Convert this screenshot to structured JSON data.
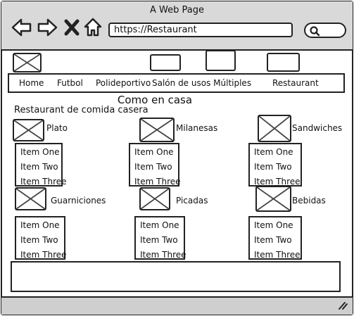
{
  "window": {
    "title": "A Web Page"
  },
  "browser": {
    "url": "https://Restaurant",
    "back_icon": "back-arrow-icon",
    "forward_icon": "forward-arrow-icon",
    "stop_icon": "close-icon",
    "home_icon": "home-icon",
    "search_icon": "search-icon"
  },
  "menu": {
    "items": [
      {
        "label": "Home"
      },
      {
        "label": "Futbol"
      },
      {
        "label": "Polideportivo"
      },
      {
        "label": "Salón de usos Múltiples"
      },
      {
        "label": "Restaurant"
      }
    ]
  },
  "page": {
    "heading": "Como en casa",
    "subheading": "Restaurant de comida casera"
  },
  "categories": [
    {
      "name": "Plato",
      "items": [
        "Item One",
        "Item Two",
        "Item Three"
      ]
    },
    {
      "name": "Milanesas",
      "items": [
        "Item One",
        "Item Two",
        "Item Three"
      ]
    },
    {
      "name": "Sandwiches",
      "items": [
        "Item One",
        "Item Two",
        "Item Three"
      ]
    },
    {
      "name": "Guarniciones",
      "items": [
        "Item One",
        "Item Two",
        "Item Three"
      ]
    },
    {
      "name": "Picadas",
      "items": [
        "Item One",
        "Item Two",
        "Item Three"
      ]
    },
    {
      "name": "Bebidas",
      "items": [
        "Item One",
        "Item Two",
        "Item Three"
      ]
    }
  ],
  "colors": {
    "chrome": "#d9d9d9",
    "statusbar": "#cfcfcf",
    "stroke": "#222222"
  }
}
